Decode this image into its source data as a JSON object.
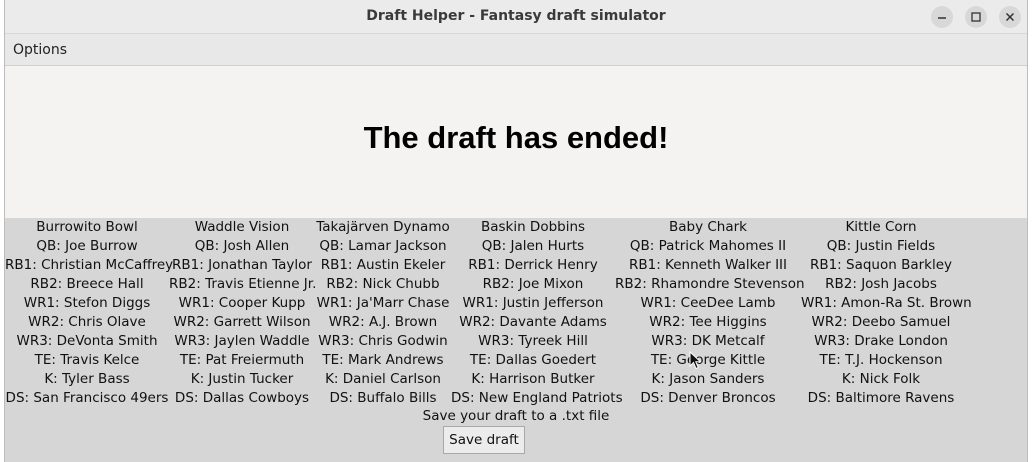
{
  "window": {
    "title": "Draft Helper - Fantasy draft simulator"
  },
  "menu": {
    "options_label": "Options"
  },
  "banner": {
    "message": "The draft has ended!"
  },
  "teams": [
    {
      "name": "Burrowito Bowl",
      "picks": [
        "QB: Joe Burrow",
        "RB1: Christian McCaffrey",
        "RB2: Breece Hall",
        "WR1: Stefon Diggs",
        "WR2: Chris Olave",
        "WR3: DeVonta Smith",
        "TE: Travis Kelce",
        "K: Tyler Bass",
        "DS: San Francisco 49ers"
      ]
    },
    {
      "name": "Waddle Vision",
      "picks": [
        "QB: Josh Allen",
        "RB1: Jonathan Taylor",
        "RB2: Travis Etienne Jr.",
        "WR1: Cooper Kupp",
        "WR2: Garrett Wilson",
        "WR3: Jaylen Waddle",
        "TE: Pat Freiermuth",
        "K: Justin Tucker",
        "DS: Dallas Cowboys"
      ]
    },
    {
      "name": "Takajärven Dynamo",
      "picks": [
        "QB: Lamar Jackson",
        "RB1: Austin Ekeler",
        "RB2: Nick Chubb",
        "WR1: Ja'Marr Chase",
        "WR2: A.J. Brown",
        "WR3: Chris Godwin",
        "TE: Mark Andrews",
        "K: Daniel Carlson",
        "DS: Buffalo Bills"
      ]
    },
    {
      "name": "Baskin Dobbins",
      "picks": [
        "QB: Jalen Hurts",
        "RB1: Derrick Henry",
        "RB2: Joe Mixon",
        "WR1: Justin Jefferson",
        "WR2: Davante Adams",
        "WR3: Tyreek Hill",
        "TE: Dallas Goedert",
        "K: Harrison Butker",
        "DS: New England Patriots"
      ]
    },
    {
      "name": "Baby Chark",
      "picks": [
        "QB: Patrick Mahomes II",
        "RB1: Kenneth Walker III",
        "RB2: Rhamondre Stevenson",
        "WR1: CeeDee Lamb",
        "WR2: Tee Higgins",
        "WR3: DK Metcalf",
        "TE: George Kittle",
        "K: Jason Sanders",
        "DS: Denver Broncos"
      ]
    },
    {
      "name": "Kittle Corn",
      "picks": [
        "QB: Justin Fields",
        "RB1: Saquon Barkley",
        "RB2: Josh Jacobs",
        "WR1: Amon-Ra St. Brown",
        "WR2: Deebo Samuel",
        "WR3: Drake London",
        "TE: T.J. Hockenson",
        "K: Nick Folk",
        "DS: Baltimore Ravens"
      ]
    }
  ],
  "save": {
    "prompt": "Save your draft to a .txt file",
    "button_label": "Save draft"
  },
  "icons": {
    "minimize": "minimize-icon",
    "maximize": "maximize-icon",
    "close": "close-icon",
    "cursor": "mouse-pointer-icon"
  }
}
